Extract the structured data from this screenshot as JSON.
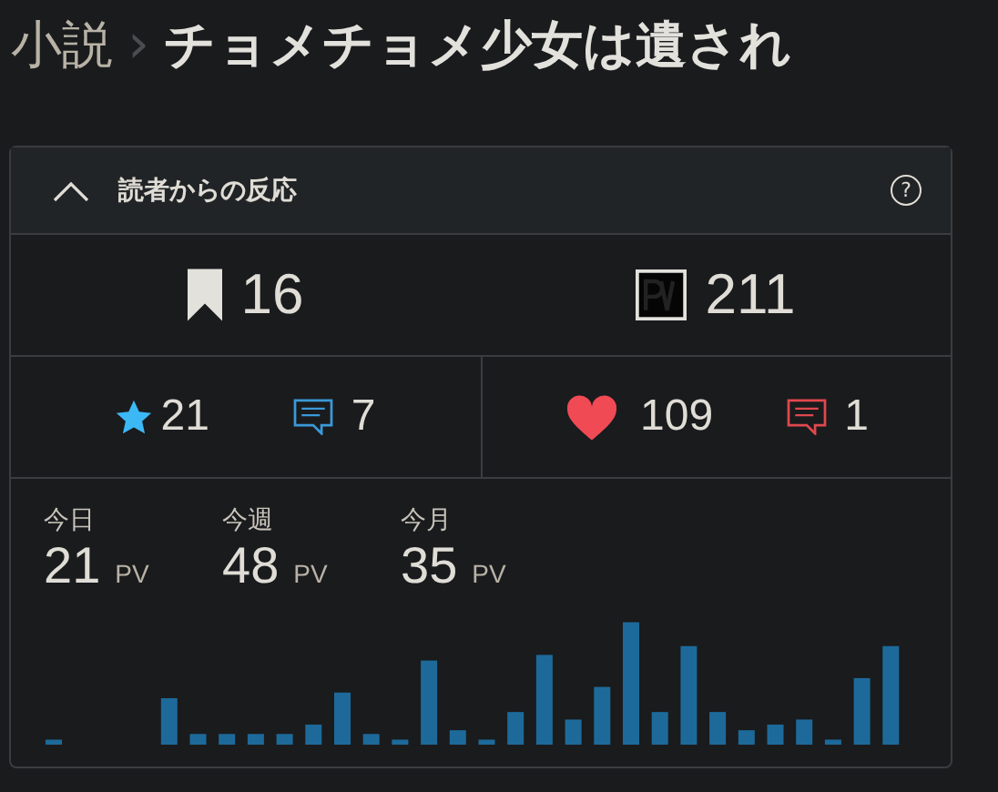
{
  "breadcrumb": {
    "section": "小説",
    "separator": "›",
    "title": "チョメチョメ少女は遺され"
  },
  "panel": {
    "title": "読者からの反応",
    "expanded": true,
    "help": "?"
  },
  "totals": [
    {
      "kind": "bookmark",
      "value": "16"
    },
    {
      "kind": "pv",
      "value": "211"
    }
  ],
  "reactions": [
    {
      "kind": "star",
      "value": "21"
    },
    {
      "kind": "comment",
      "value": "7",
      "color": "#3a9ad9"
    },
    {
      "kind": "heart",
      "value": "109"
    },
    {
      "kind": "comment",
      "value": "1",
      "color": "#e0484e"
    }
  ],
  "periods": [
    {
      "label": "今日",
      "value": "21",
      "unit": "PV"
    },
    {
      "label": "今週",
      "value": "48",
      "unit": "PV"
    },
    {
      "label": "今月",
      "value": "35",
      "unit": "PV"
    }
  ]
}
